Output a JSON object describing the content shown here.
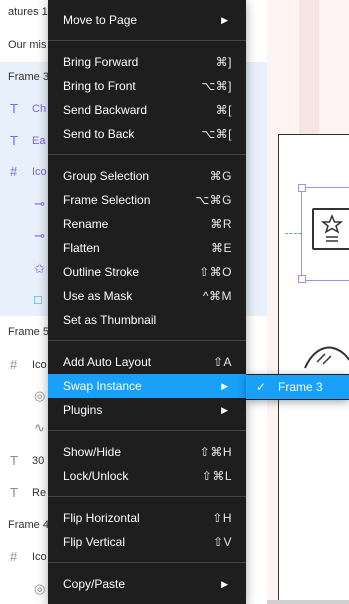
{
  "layers": {
    "items": [
      {
        "label": "atures 1",
        "icon": "",
        "kind": "plain"
      },
      {
        "label": "Our mis",
        "icon": "",
        "kind": "plain"
      },
      {
        "label": "Frame 3",
        "icon": "",
        "kind": "selected"
      },
      {
        "label": "Ch",
        "icon": "T",
        "kind": "purple"
      },
      {
        "label": "Ea",
        "icon": "T",
        "kind": "purple"
      },
      {
        "label": "Ico",
        "icon": "#",
        "kind": "purple"
      },
      {
        "label": "",
        "icon": "⊸",
        "kind": "purple"
      },
      {
        "label": "",
        "icon": "⊸",
        "kind": "purple"
      },
      {
        "label": "",
        "icon": "✩",
        "kind": "purple"
      },
      {
        "label": "",
        "icon": "□",
        "kind": "blue"
      },
      {
        "label": "Frame 5",
        "icon": "",
        "kind": "plain"
      },
      {
        "label": "Ico",
        "icon": "#",
        "kind": "plain"
      },
      {
        "label": "",
        "icon": "◎",
        "kind": "gray"
      },
      {
        "label": "",
        "icon": "∿",
        "kind": "gray"
      },
      {
        "label": "30",
        "icon": "T",
        "kind": "plain"
      },
      {
        "label": "Re",
        "icon": "T",
        "kind": "plain"
      },
      {
        "label": "Frame 4",
        "icon": "",
        "kind": "plain"
      },
      {
        "label": "Ico",
        "icon": "#",
        "kind": "plain"
      },
      {
        "label": "",
        "icon": "◎",
        "kind": "gray"
      }
    ]
  },
  "menu": {
    "items": [
      {
        "label": "Move to Page",
        "shortcut": "",
        "submenu": true
      },
      {
        "label": "Bring Forward",
        "shortcut": "⌘]",
        "submenu": false
      },
      {
        "label": "Bring to Front",
        "shortcut": "⌥⌘]",
        "submenu": false
      },
      {
        "label": "Send Backward",
        "shortcut": "⌘[",
        "submenu": false
      },
      {
        "label": "Send to Back",
        "shortcut": "⌥⌘[",
        "submenu": false
      },
      {
        "label": "Group Selection",
        "shortcut": "⌘G",
        "submenu": false
      },
      {
        "label": "Frame Selection",
        "shortcut": "⌥⌘G",
        "submenu": false
      },
      {
        "label": "Rename",
        "shortcut": "⌘R",
        "submenu": false
      },
      {
        "label": "Flatten",
        "shortcut": "⌘E",
        "submenu": false
      },
      {
        "label": "Outline Stroke",
        "shortcut": "⇧⌘O",
        "submenu": false
      },
      {
        "label": "Use as Mask",
        "shortcut": "^⌘M",
        "submenu": false
      },
      {
        "label": "Set as Thumbnail",
        "shortcut": "",
        "submenu": false
      },
      {
        "label": "Add Auto Layout",
        "shortcut": "⇧A",
        "submenu": false
      },
      {
        "label": "Swap Instance",
        "shortcut": "",
        "submenu": true,
        "active": true
      },
      {
        "label": "Plugins",
        "shortcut": "",
        "submenu": true
      },
      {
        "label": "Show/Hide",
        "shortcut": "⇧⌘H",
        "submenu": false
      },
      {
        "label": "Lock/Unlock",
        "shortcut": "⇧⌘L",
        "submenu": false
      },
      {
        "label": "Flip Horizontal",
        "shortcut": "⇧H",
        "submenu": false
      },
      {
        "label": "Flip Vertical",
        "shortcut": "⇧V",
        "submenu": false
      },
      {
        "label": "Copy/Paste",
        "shortcut": "",
        "submenu": true
      }
    ]
  },
  "submenu": {
    "items": [
      {
        "label": "Frame 3",
        "checked": true,
        "check_glyph": "✓"
      }
    ]
  },
  "colors": {
    "menu_bg": "#1e1e1e",
    "accent": "#18a0fb",
    "selection_purple": "#7b61ff",
    "canvas_bg": "#fdf3f3"
  }
}
